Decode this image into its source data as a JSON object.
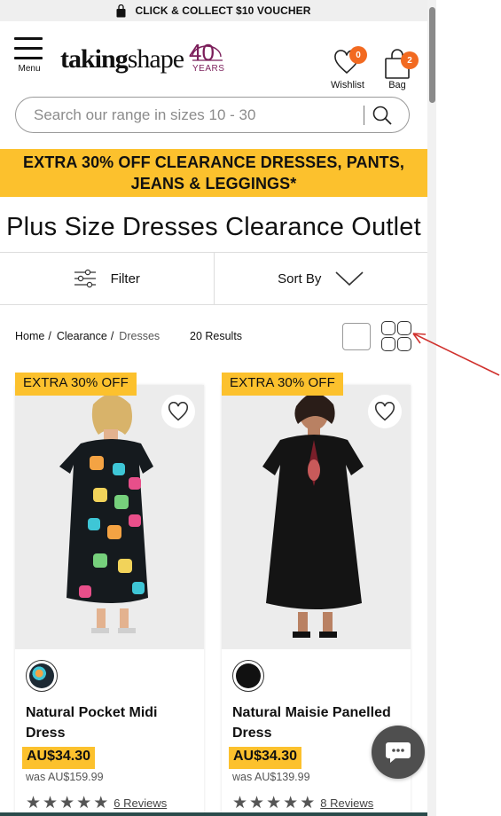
{
  "topbar": {
    "text": "CLICK & COLLECT $10 VOUCHER",
    "icon": "shopping-bag-icon"
  },
  "header": {
    "menu_label": "Menu",
    "logo": {
      "word_bold": "taking",
      "word_light": "shape",
      "forty": "40",
      "years": "YEARS"
    },
    "wishlist": {
      "label": "Wishlist",
      "count": "0",
      "icon": "heart-icon"
    },
    "bag": {
      "label": "Bag",
      "count": "2",
      "icon": "bag-icon"
    }
  },
  "search": {
    "placeholder": "Search our range in sizes 10 - 30",
    "icon": "search-icon"
  },
  "promo_banner": {
    "line1": "EXTRA 30% OFF CLEARANCE DRESSES, PANTS,",
    "line2": "JEANS & LEGGINGS*"
  },
  "page_title": "Plus Size Dresses Clearance Outlet",
  "filterbar": {
    "filter_label": "Filter",
    "sort_label": "Sort By"
  },
  "breadcrumb": {
    "items": [
      "Home",
      "Clearance",
      "Dresses"
    ],
    "separator": "/"
  },
  "results": "20 Results",
  "products": [
    {
      "tag": "EXTRA 30% OFF",
      "name": "Natural Pocket Midi Dress",
      "price": "AU$34.30",
      "was": "was AU$159.99",
      "rating": 5,
      "reviews": "6 Reviews",
      "swatch_color": "#1d2a34"
    },
    {
      "tag": "EXTRA 30% OFF",
      "name": "Natural Maisie Panelled Dress",
      "price": "AU$34.30",
      "was": "was AU$139.99",
      "rating": 5,
      "reviews": "8 Reviews",
      "swatch_color": "#111111"
    }
  ],
  "colors": {
    "accent": "#fcc12d",
    "badge": "#f26a21",
    "logo_purple": "#7b1e5a",
    "annotation_arrow": "#d0312d"
  }
}
